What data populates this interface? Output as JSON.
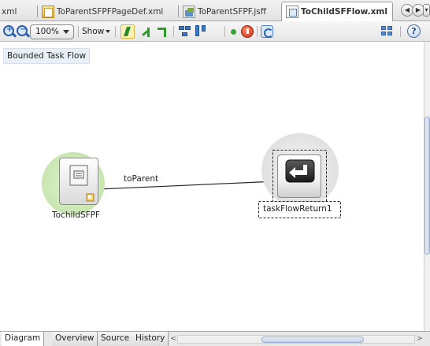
{
  "editor_tabs": [
    {
      "label": "xml",
      "icon": "none"
    },
    {
      "label": "ToParentSFPFPageDef.xml",
      "icon": "xml-file-icon"
    },
    {
      "label": "ToParentSFPF.jsff",
      "icon": "jsff-file-icon"
    },
    {
      "label": "ToChildSFFlow.xml",
      "icon": "taskflow-file-icon",
      "active": true
    }
  ],
  "toolbar": {
    "zoom_value": "100%",
    "show_label": "Show"
  },
  "canvas": {
    "title": "Bounded Task Flow",
    "nodes": [
      {
        "label": "TochildSFPF",
        "type": "view-activity"
      },
      {
        "label": "taskFlowReturn1",
        "type": "task-flow-return"
      }
    ],
    "edges": [
      {
        "label": "toParent",
        "from": "TochildSFPF",
        "to": "taskFlowReturn1"
      }
    ]
  },
  "bottom_tabs": [
    "Diagram",
    "Overview",
    "Source",
    "History"
  ],
  "colors": {
    "view_halo": "#cde9b8",
    "return_halo": "#d8d8d8",
    "selection_accent": "#2c5ea8"
  }
}
